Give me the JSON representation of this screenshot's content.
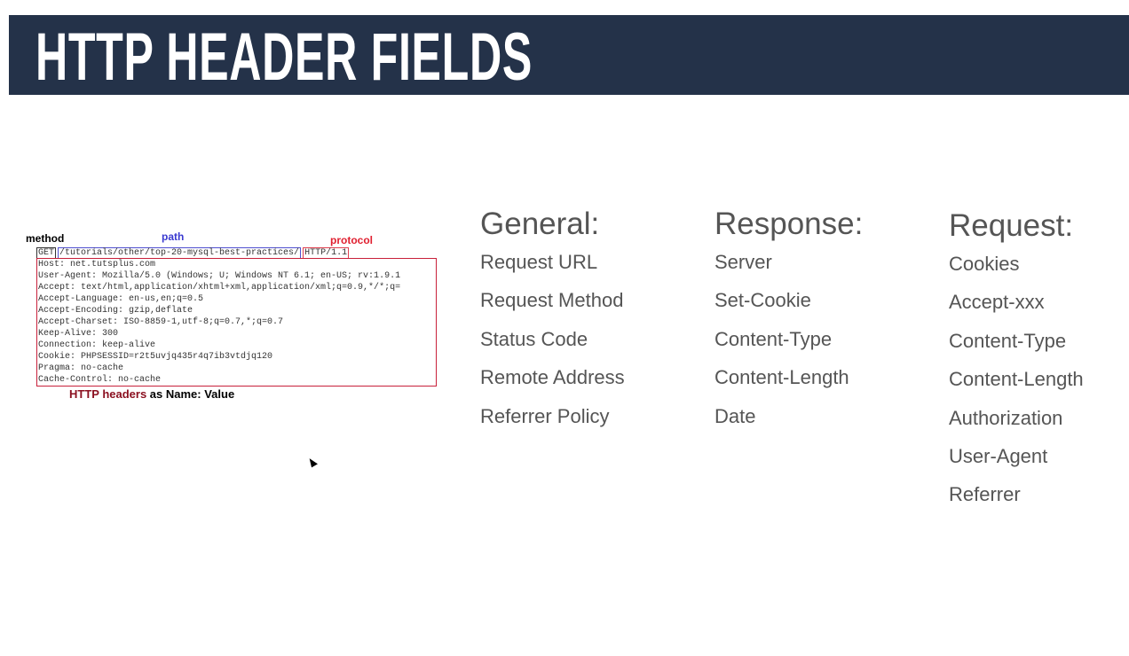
{
  "title": "HTTP HEADER FIELDS",
  "diagram": {
    "method_label": "method",
    "path_label": "path",
    "protocol_label": "protocol",
    "method": "GET",
    "path": "/tutorials/other/top-20-mysql-best-practices/",
    "protocol": "HTTP/1.1",
    "headers": [
      "Host: net.tutsplus.com",
      "User-Agent: Mozilla/5.0 (Windows; U; Windows NT 6.1; en-US; rv:1.9.1",
      "Accept: text/html,application/xhtml+xml,application/xml;q=0.9,*/*;q=",
      "Accept-Language: en-us,en;q=0.5",
      "Accept-Encoding: gzip,deflate",
      "Accept-Charset: ISO-8859-1,utf-8;q=0.7,*;q=0.7",
      "Keep-Alive: 300",
      "Connection: keep-alive",
      "Cookie: PHPSESSID=r2t5uvjq435r4q7ib3vtdjq120",
      "Pragma: no-cache",
      "Cache-Control: no-cache"
    ],
    "caption_highlight": "HTTP headers",
    "caption_rest": " as Name: Value"
  },
  "columns": [
    {
      "heading": "General:",
      "items": [
        "Request URL",
        "Request Method",
        "Status Code",
        "Remote Address",
        "Referrer Policy"
      ]
    },
    {
      "heading": "Response:",
      "items": [
        "Server",
        "Set-Cookie",
        "Content-Type",
        "Content-Length",
        "Date"
      ]
    },
    {
      "heading": "Request:",
      "items": [
        "Cookies",
        "Accept-xxx",
        "Content-Type",
        "Content-Length",
        "Authorization",
        "User-Agent",
        "Referrer"
      ]
    }
  ],
  "colors": {
    "banner": "#243249",
    "method": "#000000",
    "path": "#3a3ad0",
    "protocol": "#e02030",
    "caption_highlight": "#8b1020"
  }
}
